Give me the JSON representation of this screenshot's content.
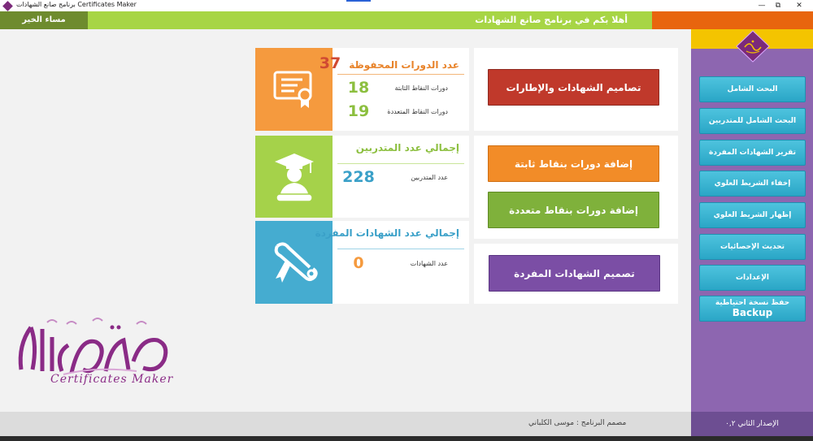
{
  "window": {
    "title": "برنامج صانع الشهادات Certificates Maker",
    "minimize": "—",
    "maximize": "⧉",
    "close": "✕"
  },
  "header": {
    "greeting": "مساء الخير",
    "welcome": "أهلا بكم في برنامج صانع الشهادات"
  },
  "stats": {
    "courses": {
      "title": "عدد الدورات المحفوظة",
      "total": "37",
      "rows": [
        {
          "label": "دورات النقاط الثابتة",
          "value": "18"
        },
        {
          "label": "دورات النقاط المتعددة",
          "value": "19"
        }
      ]
    },
    "trainees": {
      "title": "إجمالي عدد المتدربين",
      "rows": [
        {
          "label": "عدد المتدربين",
          "value": "228"
        }
      ]
    },
    "certificates": {
      "title": "إجمالي عدد الشهادات المفردة",
      "rows": [
        {
          "label": "عدد الشهادات",
          "value": "0"
        }
      ]
    }
  },
  "actions": {
    "designs": "تصاميم الشهادات والإطارات",
    "add_fixed": "إضافة دورات بنقاط ثابتة",
    "add_multi": "إضافة دورات بنقاط متعددة",
    "single_design": "تصميم الشهادات المفردة"
  },
  "sidebar": {
    "items": [
      {
        "label": "البحث الشامل"
      },
      {
        "label": "البحث الشامل للمتدربين"
      },
      {
        "label": "تقرير الشهادات المفردة"
      },
      {
        "label": "إخفاء الشريط العلوي"
      },
      {
        "label": "إظهار الشريط العلوي"
      },
      {
        "label": "تحديث الإحصائيات"
      },
      {
        "label": "الإعدادات"
      },
      {
        "label": "حفظ نسخة احتياطية",
        "sub": "Backup"
      }
    ]
  },
  "brand": {
    "arabic": "صانع الشهادات",
    "english": "Certificates Maker"
  },
  "status": {
    "designer": "مصمم البرنامج : موسى الكلباني",
    "version": "الإصدار الثاني ٠,٢"
  },
  "colors": {
    "orange": "#f59a3e",
    "green": "#a5d24a",
    "teal": "#45acd0",
    "red": "#c0392b",
    "purple": "#7b4ea5",
    "sidebar": "#8d66b0"
  }
}
